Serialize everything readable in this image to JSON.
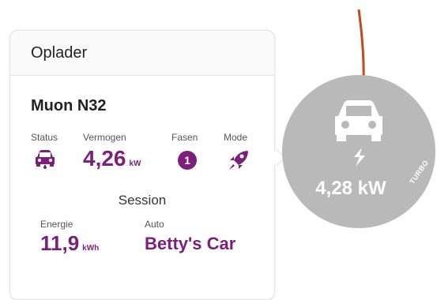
{
  "card": {
    "title": "Oplader",
    "device_name": "Muon N32",
    "status_label": "Status",
    "status_icon": "car-icon",
    "power_label": "Vermogen",
    "power_value": "4,26",
    "power_unit": "kW",
    "phases_label": "Fasen",
    "phases_value": "1",
    "mode_label": "Mode",
    "mode_icon": "rocket-icon",
    "session_title": "Session",
    "energy_label": "Energie",
    "energy_value": "11,9",
    "energy_unit": "kWh",
    "car_label": "Auto",
    "car_value": "Betty's Car"
  },
  "charger_node": {
    "icon": "ev-charging-icon",
    "power": "4,28 kW",
    "badge": "TURBO",
    "cable_color": "#c24a1e",
    "circle_color": "#b9b9b9"
  },
  "colors": {
    "accent": "#7a1f7a"
  }
}
